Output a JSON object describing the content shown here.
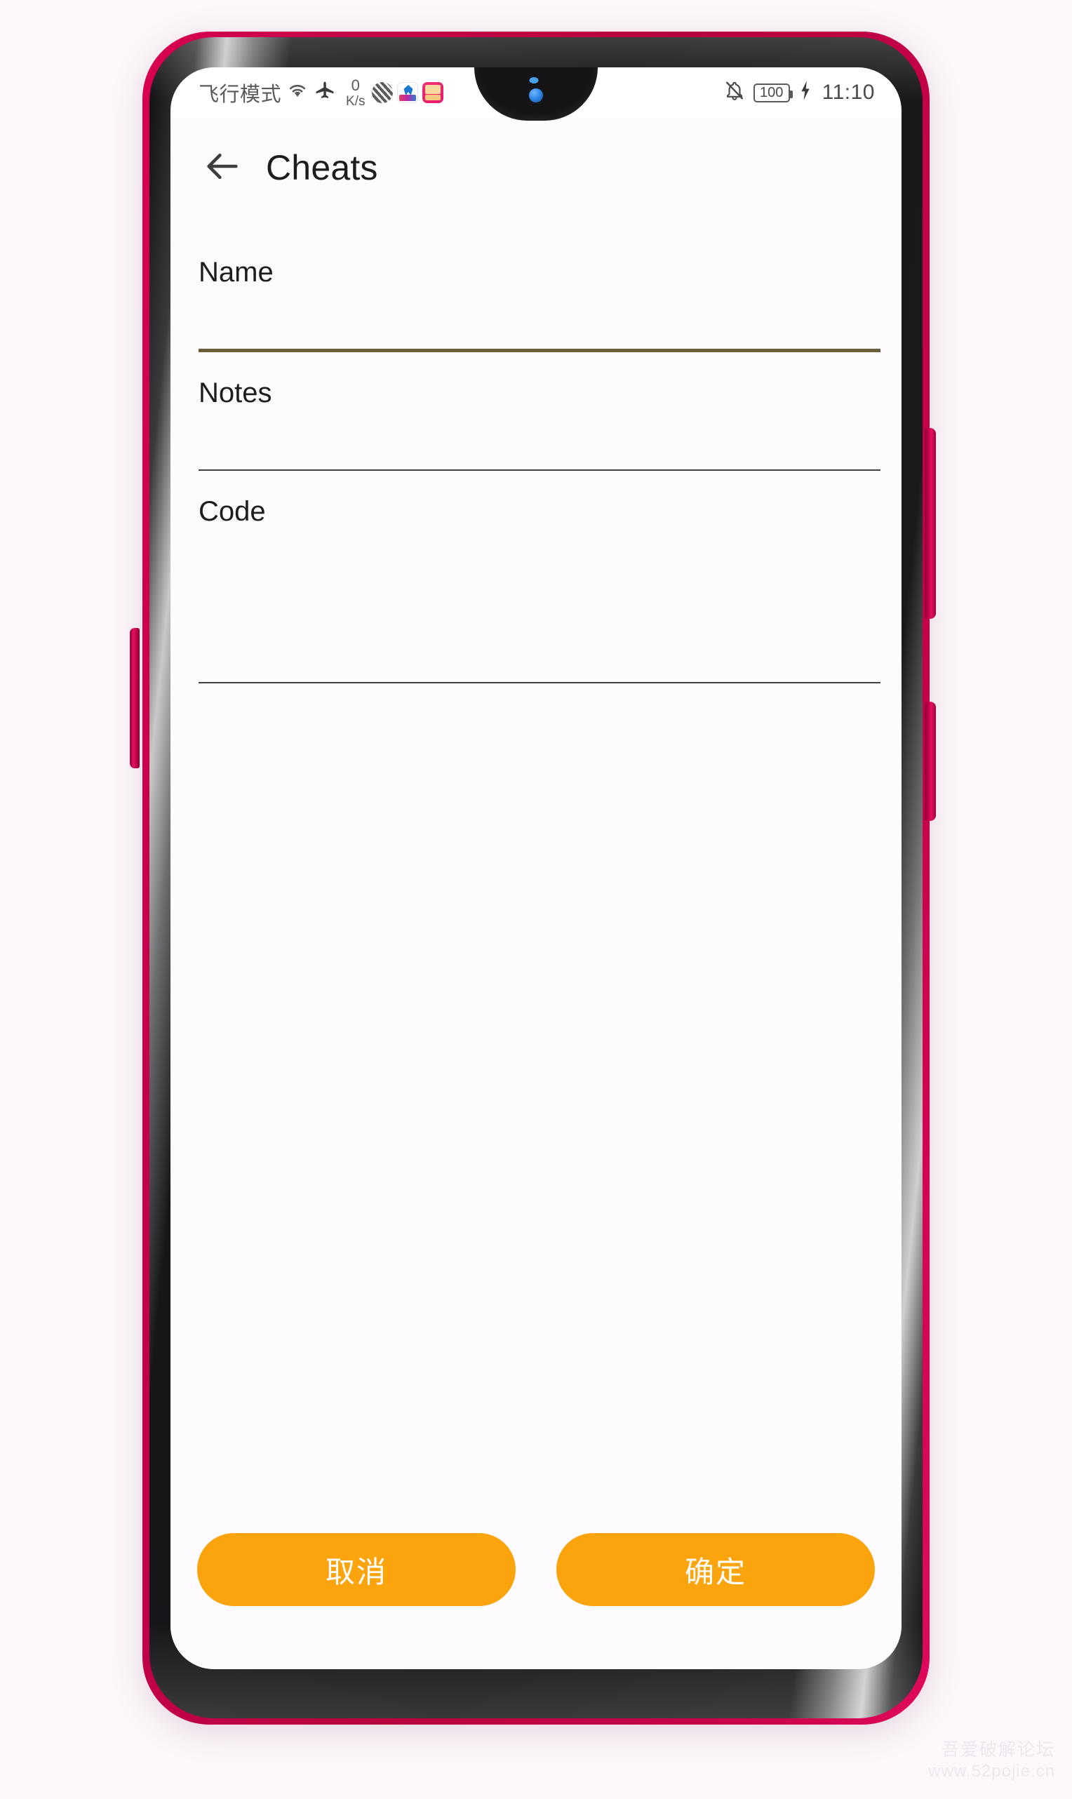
{
  "device": {
    "frame_color": "#c2004a",
    "bezel_color": "#141417"
  },
  "status_bar": {
    "airplane_mode_text": "飞行模式",
    "wifi_icon": "wifi-icon",
    "airplane_icon": "airplane-icon",
    "net_speed_value": "0",
    "net_speed_unit": "K/s",
    "tray_app_1": "app-icon-weather",
    "tray_app_2": "app-icon-telecom",
    "tray_app_3": "app-icon-hebao",
    "mute_icon": "bell-muted-icon",
    "battery_level": "100",
    "charging_icon": "charging-bolt-icon",
    "time": "11:10"
  },
  "app_bar": {
    "back_icon": "back-arrow-icon",
    "title": "Cheats"
  },
  "form": {
    "fields": [
      {
        "label": "Name",
        "value": "",
        "placeholder": "",
        "focused": true
      },
      {
        "label": "Notes",
        "value": "",
        "placeholder": "",
        "focused": false
      },
      {
        "label": "Code",
        "value": "",
        "placeholder": "",
        "focused": false
      }
    ]
  },
  "buttons": {
    "cancel_label": "取消",
    "confirm_label": "确定",
    "accent_color": "#fba40d",
    "text_color": "#ffffff"
  },
  "focus": {
    "underline_color": "#6c5d3a",
    "idle_underline_color": "#3f3f46"
  },
  "watermark": {
    "line1": "吾爱破解论坛",
    "line2": "www.52pojie.cn"
  }
}
